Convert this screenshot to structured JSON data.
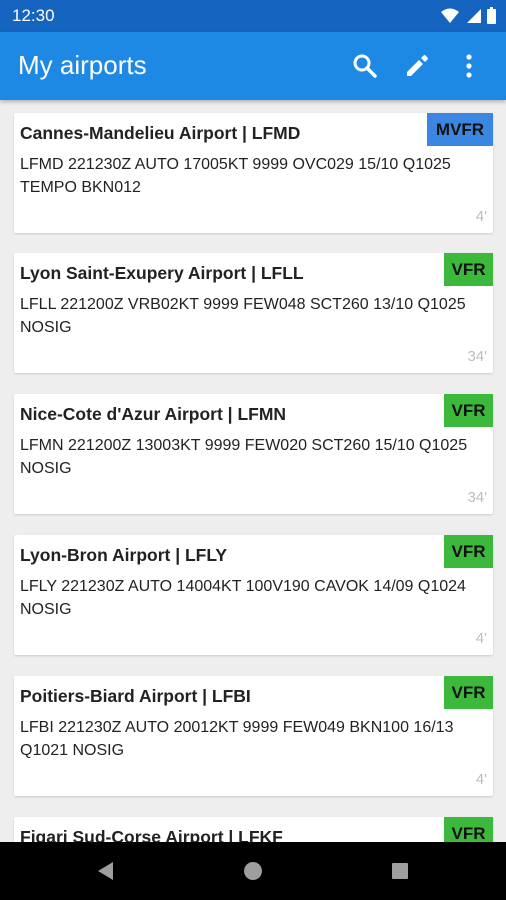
{
  "status_bar": {
    "time": "12:30"
  },
  "app_bar": {
    "title": "My airports"
  },
  "airports": [
    {
      "name": "Cannes-Mandelieu Airport | LFMD",
      "category": "MVFR",
      "category_class": "mvfr",
      "metar": "LFMD 221230Z AUTO 17005KT 9999 OVC029 15/10 Q1025 TEMPO BKN012",
      "age": "4'"
    },
    {
      "name": "Lyon Saint-Exupery Airport | LFLL",
      "category": "VFR",
      "category_class": "vfr",
      "metar": "LFLL 221200Z VRB02KT 9999 FEW048 SCT260 13/10 Q1025 NOSIG",
      "age": "34'"
    },
    {
      "name": "Nice-Cote d'Azur Airport | LFMN",
      "category": "VFR",
      "category_class": "vfr",
      "metar": "LFMN 221200Z 13003KT 9999 FEW020 SCT260 15/10 Q1025 NOSIG",
      "age": "34'"
    },
    {
      "name": "Lyon-Bron Airport | LFLY",
      "category": "VFR",
      "category_class": "vfr",
      "metar": "LFLY 221230Z AUTO 14004KT 100V190 CAVOK 14/09 Q1024 NOSIG",
      "age": "4'"
    },
    {
      "name": "Poitiers-Biard Airport | LFBI",
      "category": "VFR",
      "category_class": "vfr",
      "metar": "LFBI 221230Z AUTO 20012KT 9999 FEW049 BKN100 16/13 Q1021 NOSIG",
      "age": "4'"
    },
    {
      "name": "Figari Sud-Corse Airport | LFKF",
      "category": "VFR",
      "category_class": "vfr",
      "metar": "",
      "age": ""
    }
  ],
  "colors": {
    "primary": "#1e88e5",
    "primary_dark": "#1565c0",
    "vfr": "#3cb93c",
    "mvfr": "#3a86e0"
  },
  "icons": [
    "search-icon",
    "edit-icon",
    "more-vert-icon",
    "wifi-icon",
    "signal-icon",
    "battery-icon",
    "back-icon",
    "home-icon",
    "recents-icon"
  ]
}
